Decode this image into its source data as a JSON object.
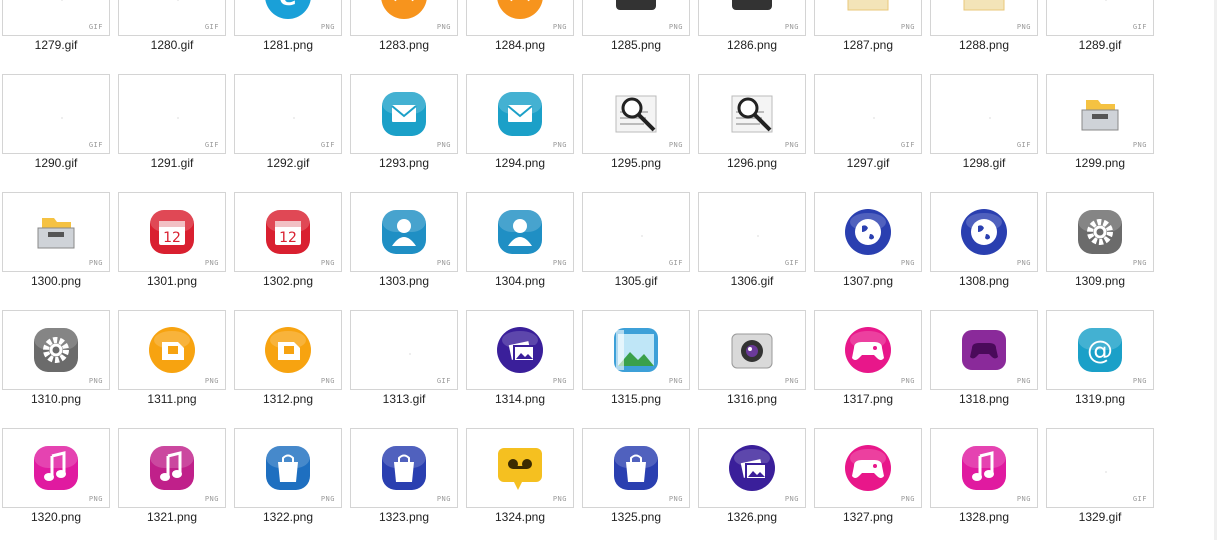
{
  "files": [
    {
      "name": "1279.gif",
      "ext": "GIF",
      "icon": "blank"
    },
    {
      "name": "1280.gif",
      "ext": "GIF",
      "icon": "blank"
    },
    {
      "name": "1281.png",
      "ext": "PNG",
      "icon": "e-circle-icon",
      "color": "#1aa0d8"
    },
    {
      "name": "1283.png",
      "ext": "PNG",
      "icon": "orange-app-icon",
      "color": "#f7941d"
    },
    {
      "name": "1284.png",
      "ext": "PNG",
      "icon": "orange-app-icon",
      "color": "#f7941d"
    },
    {
      "name": "1285.png",
      "ext": "PNG",
      "icon": "dark-device-icon",
      "color": "#333333"
    },
    {
      "name": "1286.png",
      "ext": "PNG",
      "icon": "dark-device-icon",
      "color": "#333333"
    },
    {
      "name": "1287.png",
      "ext": "PNG",
      "icon": "envelope-icon",
      "color": "#e8c77a"
    },
    {
      "name": "1288.png",
      "ext": "PNG",
      "icon": "envelope-icon",
      "color": "#e8c77a"
    },
    {
      "name": "1289.gif",
      "ext": "GIF",
      "icon": "blank"
    },
    {
      "name": "1290.gif",
      "ext": "GIF",
      "icon": "blank"
    },
    {
      "name": "1291.gif",
      "ext": "GIF",
      "icon": "blank"
    },
    {
      "name": "1292.gif",
      "ext": "GIF",
      "icon": "blank"
    },
    {
      "name": "1293.png",
      "ext": "PNG",
      "icon": "mail-icon",
      "color": "#1ba0c8"
    },
    {
      "name": "1294.png",
      "ext": "PNG",
      "icon": "mail-icon",
      "color": "#1ba0c8"
    },
    {
      "name": "1295.png",
      "ext": "PNG",
      "icon": "magnifier-doc-icon",
      "color": "#666666"
    },
    {
      "name": "1296.png",
      "ext": "PNG",
      "icon": "magnifier-doc-icon",
      "color": "#666666"
    },
    {
      "name": "1297.gif",
      "ext": "GIF",
      "icon": "blank"
    },
    {
      "name": "1298.gif",
      "ext": "GIF",
      "icon": "blank"
    },
    {
      "name": "1299.png",
      "ext": "PNG",
      "icon": "folder-drawer-icon",
      "color": "#f5c242"
    },
    {
      "name": "1300.png",
      "ext": "PNG",
      "icon": "folder-drawer-icon",
      "color": "#f5c242"
    },
    {
      "name": "1301.png",
      "ext": "PNG",
      "icon": "calendar-icon",
      "color": "#d92030"
    },
    {
      "name": "1302.png",
      "ext": "PNG",
      "icon": "calendar-icon",
      "color": "#d92030"
    },
    {
      "name": "1303.png",
      "ext": "PNG",
      "icon": "contact-icon",
      "color": "#1f8fc4"
    },
    {
      "name": "1304.png",
      "ext": "PNG",
      "icon": "contact-icon",
      "color": "#1f8fc4"
    },
    {
      "name": "1305.gif",
      "ext": "GIF",
      "icon": "blank"
    },
    {
      "name": "1306.gif",
      "ext": "GIF",
      "icon": "blank"
    },
    {
      "name": "1307.png",
      "ext": "PNG",
      "icon": "globe-icon",
      "color": "#2a3fb0"
    },
    {
      "name": "1308.png",
      "ext": "PNG",
      "icon": "globe-icon",
      "color": "#2a3fb0"
    },
    {
      "name": "1309.png",
      "ext": "PNG",
      "icon": "gear-icon",
      "color": "#6b6b6b"
    },
    {
      "name": "1310.png",
      "ext": "PNG",
      "icon": "gear-icon",
      "color": "#6b6b6b"
    },
    {
      "name": "1311.png",
      "ext": "PNG",
      "icon": "sim-card-icon",
      "color": "#f7a310"
    },
    {
      "name": "1312.png",
      "ext": "PNG",
      "icon": "sim-card-icon",
      "color": "#f7a310"
    },
    {
      "name": "1313.gif",
      "ext": "GIF",
      "icon": "blank"
    },
    {
      "name": "1314.png",
      "ext": "PNG",
      "icon": "gallery-icon",
      "color": "#3a1f9a"
    },
    {
      "name": "1315.png",
      "ext": "PNG",
      "icon": "landscape-gallery-icon",
      "color": "#3da0d8"
    },
    {
      "name": "1316.png",
      "ext": "PNG",
      "icon": "camera-icon",
      "color": "#888888"
    },
    {
      "name": "1317.png",
      "ext": "PNG",
      "icon": "gamepad-icon",
      "color": "#e8178a"
    },
    {
      "name": "1318.png",
      "ext": "PNG",
      "icon": "gamepad-folder-icon",
      "color": "#8a2a9a"
    },
    {
      "name": "1319.png",
      "ext": "PNG",
      "icon": "at-sign-icon",
      "color": "#1aa0c8"
    },
    {
      "name": "1320.png",
      "ext": "PNG",
      "icon": "music-note-icon",
      "color": "#e01aa0"
    },
    {
      "name": "1321.png",
      "ext": "PNG",
      "icon": "music-note-icon",
      "color": "#c0208a"
    },
    {
      "name": "1322.png",
      "ext": "PNG",
      "icon": "shopping-bag-icon",
      "color": "#1e6fc0"
    },
    {
      "name": "1323.png",
      "ext": "PNG",
      "icon": "shopping-bag-icon",
      "color": "#2a3fb0"
    },
    {
      "name": "1324.png",
      "ext": "PNG",
      "icon": "voicemail-icon",
      "color": "#f5c020"
    },
    {
      "name": "1325.png",
      "ext": "PNG",
      "icon": "shopping-bag-icon",
      "color": "#2a3fb0"
    },
    {
      "name": "1326.png",
      "ext": "PNG",
      "icon": "gallery-icon",
      "color": "#3a1f9a"
    },
    {
      "name": "1327.png",
      "ext": "PNG",
      "icon": "gamepad-icon",
      "color": "#e8178a"
    },
    {
      "name": "1328.png",
      "ext": "PNG",
      "icon": "music-note-icon",
      "color": "#e01aa0"
    },
    {
      "name": "1329.gif",
      "ext": "GIF",
      "icon": "blank"
    }
  ]
}
